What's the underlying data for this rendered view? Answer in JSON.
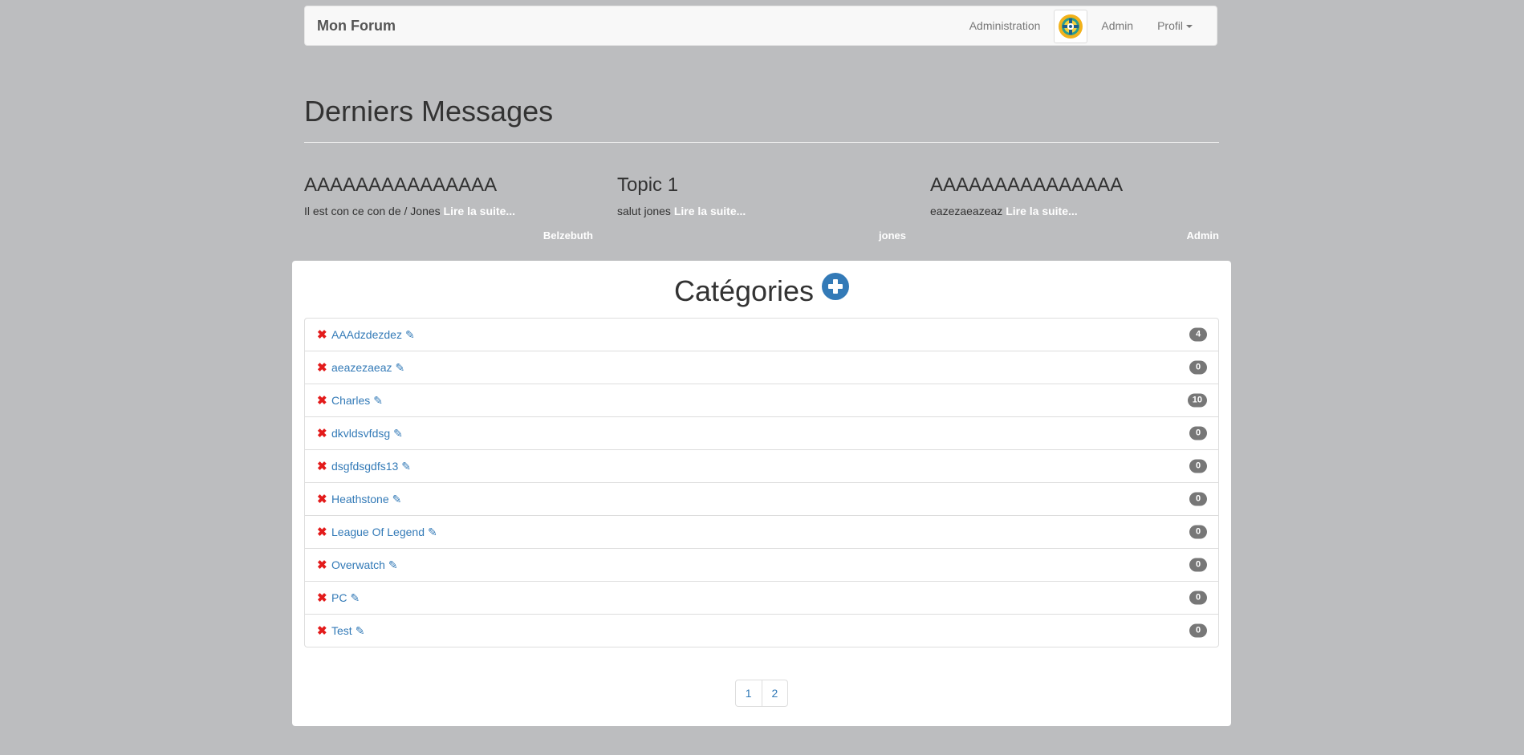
{
  "navbar": {
    "brand": "Mon Forum",
    "admin_link": "Administration",
    "user_name": "Admin",
    "profile_menu": "Profil"
  },
  "header": {
    "title": "Derniers Messages"
  },
  "latest_messages": [
    {
      "title": "AAAAAAAAAAAAAAA",
      "excerpt": "Il est con ce con de / Jones",
      "read_more": "Lire la suite...",
      "author": "Belzebuth"
    },
    {
      "title": "Topic 1",
      "excerpt": "salut jones",
      "read_more": "Lire la suite...",
      "author": "jones"
    },
    {
      "title": "AAAAAAAAAAAAAAA",
      "excerpt": "eazezaeazeaz",
      "read_more": "Lire la suite...",
      "author": "Admin"
    }
  ],
  "categories": {
    "title": "Catégories",
    "items": [
      {
        "name": "AAAdzdezdez",
        "count": "4"
      },
      {
        "name": "aeazezaeaz",
        "count": "0"
      },
      {
        "name": "Charles",
        "count": "10"
      },
      {
        "name": "dkvldsvfdsg",
        "count": "0"
      },
      {
        "name": "dsgfdsgdfs13",
        "count": "0"
      },
      {
        "name": "Heathstone",
        "count": "0"
      },
      {
        "name": "League Of Legend",
        "count": "0"
      },
      {
        "name": "Overwatch",
        "count": "0"
      },
      {
        "name": "PC",
        "count": "0"
      },
      {
        "name": "Test",
        "count": "0"
      }
    ]
  },
  "pagination": [
    "1",
    "2"
  ],
  "icons": {
    "delete": "✖",
    "edit": "✎",
    "add": "plus-circle-icon"
  },
  "colors": {
    "background": "#bcbdbf",
    "link": "#337ab7",
    "delete": "#e31b1b",
    "badge": "#777777"
  }
}
